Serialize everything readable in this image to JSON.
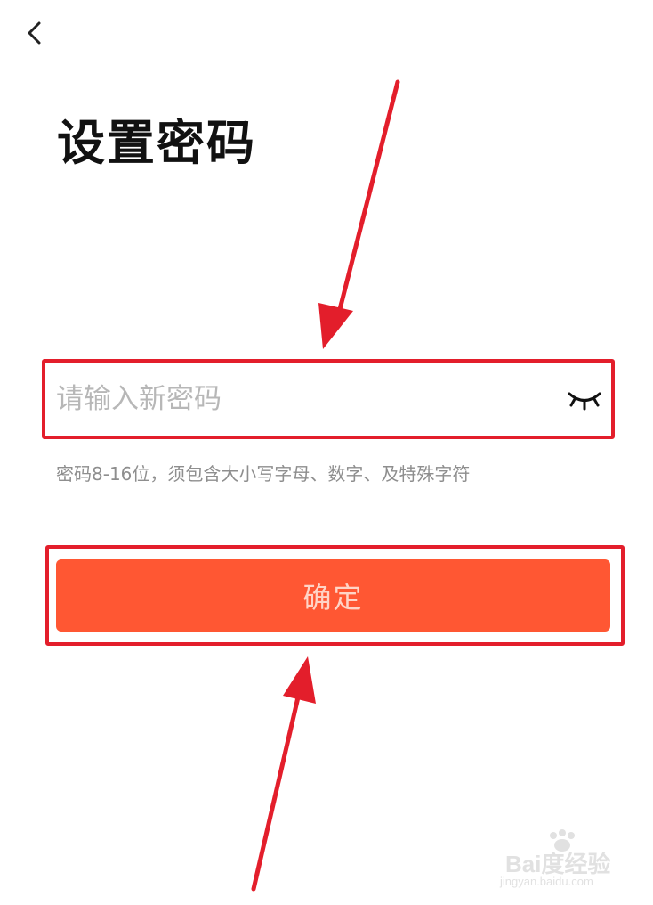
{
  "header": {
    "back_icon": "chevron-left-icon"
  },
  "page": {
    "title": "设置密码"
  },
  "password_input": {
    "placeholder": "请输入新密码",
    "value": "",
    "visibility_icon": "eye-closed-icon"
  },
  "hint": "密码8-16位，须包含大小写字母、数字、及特殊字符",
  "confirm_button": {
    "label": "确定"
  },
  "colors": {
    "accent": "#ff5733",
    "annotation_red": "#e31e2b",
    "hint_text": "#8e8e8e",
    "placeholder_text": "#b7b7b7"
  },
  "watermark": {
    "brand": "Bai度经验",
    "url": "jingyan.baidu.com"
  }
}
